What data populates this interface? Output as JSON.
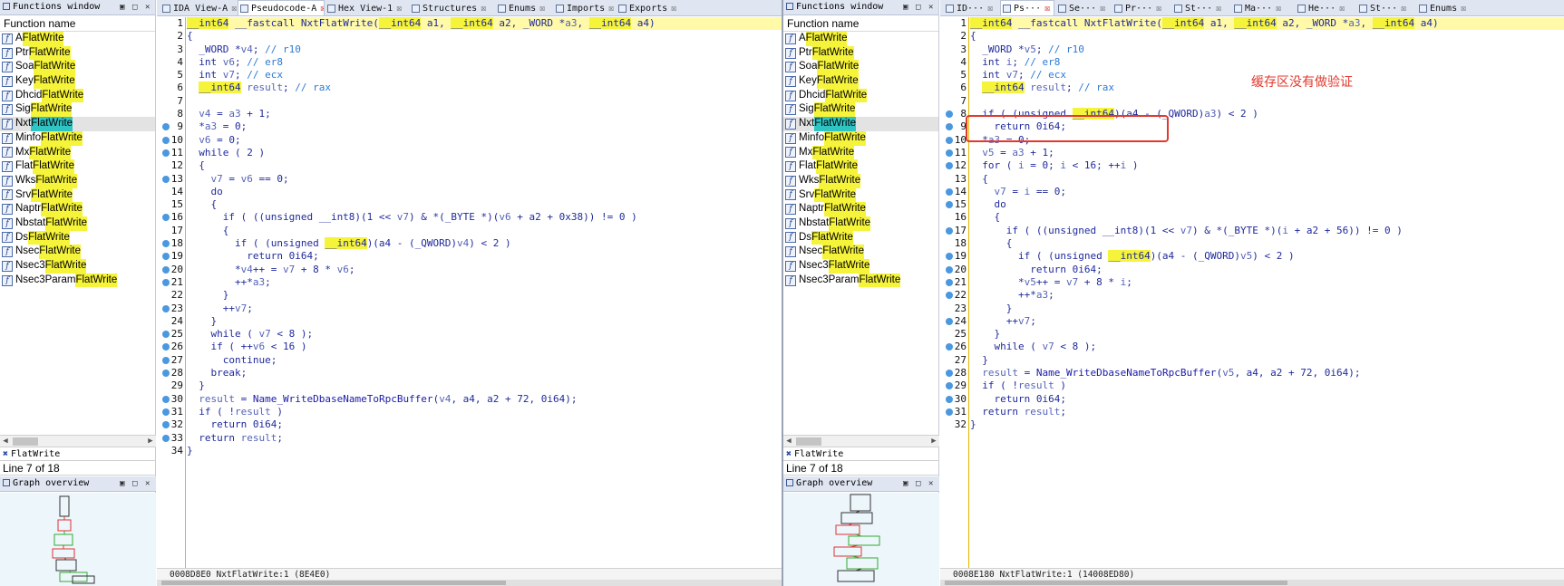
{
  "functions_window": {
    "title": "Functions window",
    "column_header": "Function name",
    "filter_text": "FlatWrite",
    "line_status": "Line 7 of 18",
    "graph_title": "Graph overview",
    "icon": "function-icon",
    "items": [
      {
        "prefix": "A",
        "match": "FlatWrite"
      },
      {
        "prefix": "Ptr",
        "match": "FlatWrite"
      },
      {
        "prefix": "Soa",
        "match": "FlatWrite"
      },
      {
        "prefix": "Key",
        "match": "FlatWrite"
      },
      {
        "prefix": "Dhcid",
        "match": "FlatWrite"
      },
      {
        "prefix": "Sig",
        "match": "FlatWrite"
      },
      {
        "prefix": "Nxt",
        "match": "FlatWrite",
        "selected": true
      },
      {
        "prefix": "Minfo",
        "match": "FlatWrite"
      },
      {
        "prefix": "Mx",
        "match": "FlatWrite"
      },
      {
        "prefix": "Flat",
        "match": "FlatWrite"
      },
      {
        "prefix": "Wks",
        "match": "FlatWrite"
      },
      {
        "prefix": "Srv",
        "match": "FlatWrite"
      },
      {
        "prefix": "Naptr",
        "match": "FlatWrite"
      },
      {
        "prefix": "Nbstat",
        "match": "FlatWrite"
      },
      {
        "prefix": "Ds",
        "match": "FlatWrite"
      },
      {
        "prefix": "Nsec",
        "match": "FlatWrite"
      },
      {
        "prefix": "Nsec3",
        "match": "FlatWrite"
      },
      {
        "prefix": "Nsec3Param",
        "match": "FlatWrite"
      }
    ]
  },
  "left": {
    "tabs": [
      "IDA View-A",
      "Pseudocode-A",
      "Hex View-1",
      "Structures",
      "Enums",
      "Imports",
      "Exports"
    ],
    "active_tab": 1,
    "status": "0008D8E0 NxtFlatWrite:1 (8E4E0)",
    "breakpoint_lines": [
      9,
      10,
      11,
      13,
      16,
      18,
      19,
      20,
      21,
      23,
      25,
      26,
      27,
      28,
      30,
      31,
      32,
      33
    ],
    "code": [
      "__int64 __fastcall NxtFlatWrite(__int64 a1, __int64 a2, _WORD *a3, __int64 a4)",
      "{",
      "  _WORD *v4; // r10",
      "  int v6; // er8",
      "  int v7; // ecx",
      "  __int64 result; // rax",
      "",
      "  v4 = a3 + 1;",
      "  *a3 = 0;",
      "  v6 = 0;",
      "  while ( 2 )",
      "  {",
      "    v7 = v6 == 0;",
      "    do",
      "    {",
      "      if ( ((unsigned __int8)(1 << v7) & *(_BYTE *)(v6 + a2 + 0x38)) != 0 )",
      "      {",
      "        if ( (unsigned __int64)(a4 - (_QWORD)v4) < 2 )",
      "          return 0i64;",
      "        *v4++ = v7 + 8 * v6;",
      "        ++*a3;",
      "      }",
      "      ++v7;",
      "    }",
      "    while ( v7 < 8 );",
      "    if ( ++v6 < 16 )",
      "      continue;",
      "    break;",
      "  }",
      "  result = Name_WriteDbaseNameToRpcBuffer(v4, a4, a2 + 72, 0i64);",
      "  if ( !result )",
      "    return 0i64;",
      "  return result;",
      "}"
    ]
  },
  "right": {
    "tabs": [
      "ID···",
      "Ps···",
      "Se···",
      "Pr···",
      "St···",
      "Ma···",
      "He···",
      "St···",
      "Enums"
    ],
    "active_tab": 1,
    "status": "0008E180 NxtFlatWrite:1 (14008ED80)",
    "breakpoint_lines": [
      8,
      9,
      10,
      11,
      12,
      14,
      15,
      17,
      19,
      20,
      21,
      22,
      24,
      26,
      28,
      29,
      30,
      31
    ],
    "annotation": "缓存区没有做验证",
    "code": [
      "__int64 __fastcall NxtFlatWrite(__int64 a1, __int64 a2, _WORD *a3, __int64 a4)",
      "{",
      "  _WORD *v5; // r10",
      "  int i; // er8",
      "  int v7; // ecx",
      "  __int64 result; // rax",
      "",
      "  if ( (unsigned __int64)(a4 - (_QWORD)a3) < 2 )",
      "    return 0i64;",
      "  *a3 = 0;",
      "  v5 = a3 + 1;",
      "  for ( i = 0; i < 16; ++i )",
      "  {",
      "    v7 = i == 0;",
      "    do",
      "    {",
      "      if ( ((unsigned __int8)(1 << v7) & *(_BYTE *)(i + a2 + 56)) != 0 )",
      "      {",
      "        if ( (unsigned __int64)(a4 - (_QWORD)v5) < 2 )",
      "          return 0i64;",
      "        *v5++ = v7 + 8 * i;",
      "        ++*a3;",
      "      }",
      "      ++v7;",
      "    }",
      "    while ( v7 < 8 );",
      "  }",
      "  result = Name_WriteDbaseNameToRpcBuffer(v5, a4, a2 + 72, 0i64);",
      "  if ( !result )",
      "    return 0i64;",
      "  return result;",
      "}"
    ]
  }
}
